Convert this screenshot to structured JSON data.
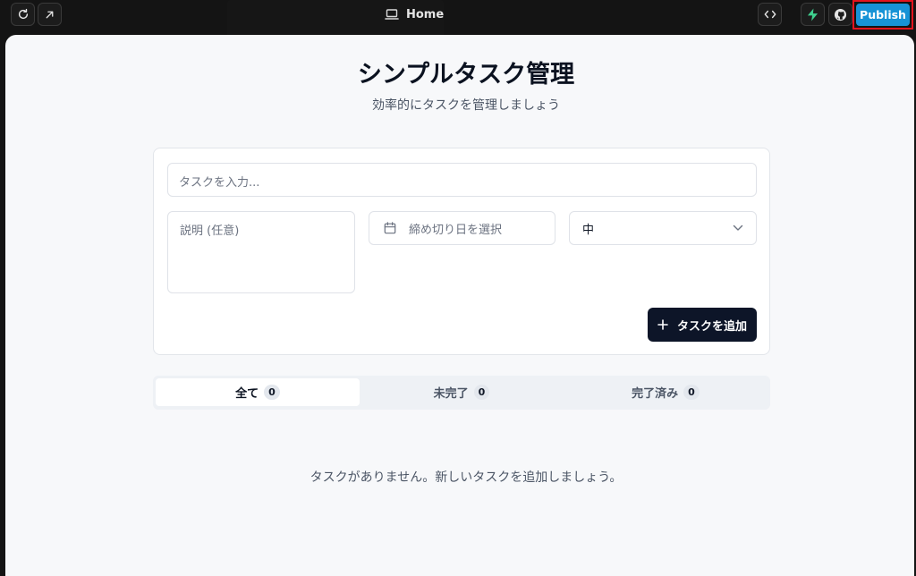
{
  "topbar": {
    "home_label": "Home",
    "publish_label": "Publish",
    "icons": [
      "refresh-icon",
      "open-external-icon",
      "laptop-icon",
      "code-icon",
      "supabase-icon",
      "github-icon"
    ]
  },
  "app": {
    "title": "シンプルタスク管理",
    "subtitle": "効率的にタスクを管理しましょう"
  },
  "form": {
    "task_placeholder": "タスクを入力...",
    "description_placeholder": "説明 (任意)",
    "due_date_placeholder": "締め切り日を選択",
    "priority_value": "中",
    "add_button_label": "タスクを追加"
  },
  "tabs": [
    {
      "label": "全て",
      "count": "0"
    },
    {
      "label": "未完了",
      "count": "0"
    },
    {
      "label": "完了済み",
      "count": "0"
    }
  ],
  "empty_message": "タスクがありません。新しいタスクを追加しましょう。",
  "colors": {
    "accent": "#1793d6",
    "primary_button": "#0d1528",
    "highlight_border": "#e3141d",
    "supabase_green": "#3ecf8e"
  }
}
